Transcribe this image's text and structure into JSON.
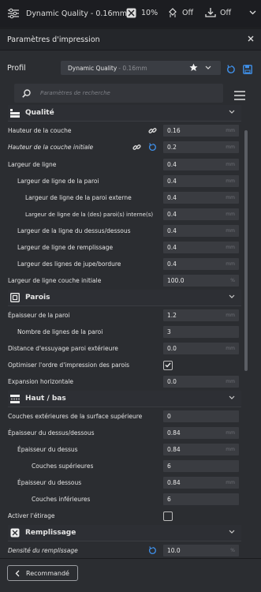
{
  "topbar": {
    "quality": "Dynamic Quality - 0.16mm",
    "infill": "10%",
    "support": "Off",
    "adhesion": "Off"
  },
  "panel": {
    "title": "Paramètres d'impression",
    "profile_label": "Profil",
    "profile_name": "Dynamic Quality",
    "profile_sub": "- 0.16mm",
    "search_placeholder": "Paramètres de recherche"
  },
  "sections": {
    "qualite": "Qualité",
    "parois": "Parois",
    "haut_bas": "Haut / bas",
    "remplissage": "Remplissage"
  },
  "rows": {
    "hauteur_couche": {
      "label": "Hauteur de la couche",
      "value": "0.16",
      "unit": "mm"
    },
    "hauteur_initiale": {
      "label": "Hauteur de la couche initiale",
      "value": "0.2",
      "unit": "mm"
    },
    "largeur_ligne": {
      "label": "Largeur de ligne",
      "value": "0.4",
      "unit": "mm"
    },
    "largeur_paroi": {
      "label": "Largeur de ligne de la paroi",
      "value": "0.4",
      "unit": "mm"
    },
    "largeur_paroi_ext": {
      "label": "Largeur de ligne de la paroi externe",
      "value": "0.4",
      "unit": "mm"
    },
    "largeur_paroi_int": {
      "label": "Largeur de ligne de la (des) paroi(s) interne(s)",
      "value": "0.4",
      "unit": "mm"
    },
    "largeur_dessus": {
      "label": "Largeur de la ligne du dessus/dessous",
      "value": "0.4",
      "unit": "mm"
    },
    "largeur_remplissage": {
      "label": "Largeur de ligne de remplissage",
      "value": "0.4",
      "unit": "mm"
    },
    "largeur_jupe": {
      "label": "Largeur des lignes de jupe/bordure",
      "value": "0.4",
      "unit": "mm"
    },
    "largeur_initiale": {
      "label": "Largeur de ligne couche initiale",
      "value": "100.0",
      "unit": "%"
    },
    "epaisseur_paroi": {
      "label": "Épaisseur de la paroi",
      "value": "1.2",
      "unit": "mm"
    },
    "nb_lignes_paroi": {
      "label": "Nombre de lignes de la paroi",
      "value": "3",
      "unit": ""
    },
    "distance_essuyage": {
      "label": "Distance d'essuyage paroi extérieure",
      "value": "0.0",
      "unit": "mm"
    },
    "optimiser_ordre": {
      "label": "Optimiser l'ordre d'impression des parois",
      "checked": true
    },
    "expansion": {
      "label": "Expansion horizontale",
      "value": "0.0",
      "unit": "mm"
    },
    "couches_ext": {
      "label": "Couches extérieures de la surface supérieure",
      "value": "0",
      "unit": ""
    },
    "epaisseur_dd": {
      "label": "Épaisseur du dessus/dessous",
      "value": "0.84",
      "unit": "mm"
    },
    "epaisseur_dessus": {
      "label": "Épaisseur du dessus",
      "value": "0.84",
      "unit": "mm"
    },
    "couches_sup": {
      "label": "Couches supérieures",
      "value": "6",
      "unit": ""
    },
    "epaisseur_dessous": {
      "label": "Épaisseur du dessous",
      "value": "0.84",
      "unit": "mm"
    },
    "couches_inf": {
      "label": "Couches inférieures",
      "value": "6",
      "unit": ""
    },
    "activer_etirage": {
      "label": "Activer l'étirage",
      "checked": false
    },
    "densite": {
      "label": "Densité du remplissage",
      "value": "10.0",
      "unit": "%"
    }
  },
  "bottom": {
    "recommended": "Recommandé"
  },
  "colors": {
    "accent": "#3f8fe8",
    "background": "#2b2d31",
    "field": "#3a3c41"
  }
}
